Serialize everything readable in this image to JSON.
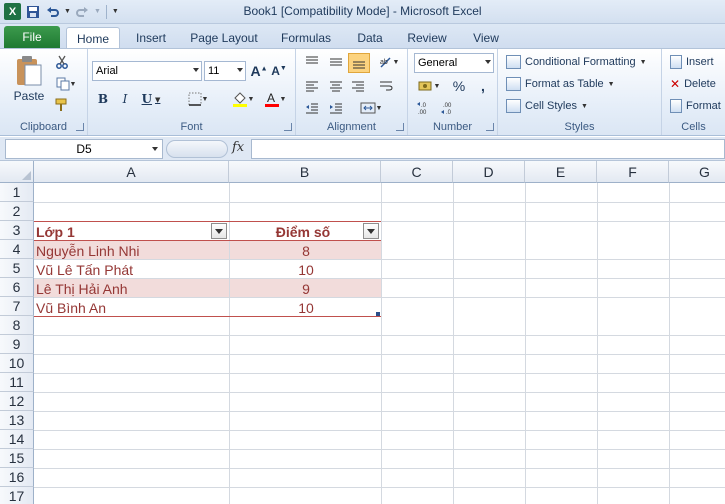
{
  "window": {
    "title": "Book1  [Compatibility Mode]  -  Microsoft Excel"
  },
  "tabs": [
    "File",
    "Home",
    "Insert",
    "Page Layout",
    "Formulas",
    "Data",
    "Review",
    "View"
  ],
  "ribbon": {
    "clipboard": {
      "paste_label": "Paste",
      "group_label": "Clipboard"
    },
    "font": {
      "font_name": "Arial",
      "font_size": "11",
      "group_label": "Font"
    },
    "alignment": {
      "group_label": "Alignment"
    },
    "number": {
      "format": "General",
      "group_label": "Number",
      "percent": "%",
      "comma": ","
    },
    "styles": {
      "conditional": "Conditional Formatting",
      "format_table": "Format as Table",
      "cell_styles": "Cell Styles",
      "group_label": "Styles"
    },
    "cells": {
      "insert": "Insert",
      "delete": "Delete",
      "format": "Format",
      "group_label": "Cells"
    }
  },
  "formula_bar": {
    "name_box": "D5",
    "fx": "fx",
    "formula": ""
  },
  "columns": [
    "A",
    "B",
    "C",
    "D",
    "E",
    "F",
    "G"
  ],
  "rows": [
    "1",
    "2",
    "3",
    "4",
    "5",
    "6",
    "7",
    "8",
    "9",
    "10",
    "11",
    "12",
    "13",
    "14",
    "15",
    "16",
    "17"
  ],
  "table": {
    "headers": [
      "Lớp 1",
      "Điểm số"
    ],
    "rows": [
      [
        "Nguyễn Linh Nhi",
        "8"
      ],
      [
        "Vũ Lê Tấn Phát",
        "10"
      ],
      [
        "Lê Thị Hải Anh",
        "9"
      ],
      [
        "Vũ Bình An",
        "10"
      ]
    ]
  },
  "colors": {
    "table_header_text": "#953735",
    "band_fill": "#f2dcdb",
    "table_border": "#c0504d",
    "file_tab": "#2a8a3f"
  }
}
